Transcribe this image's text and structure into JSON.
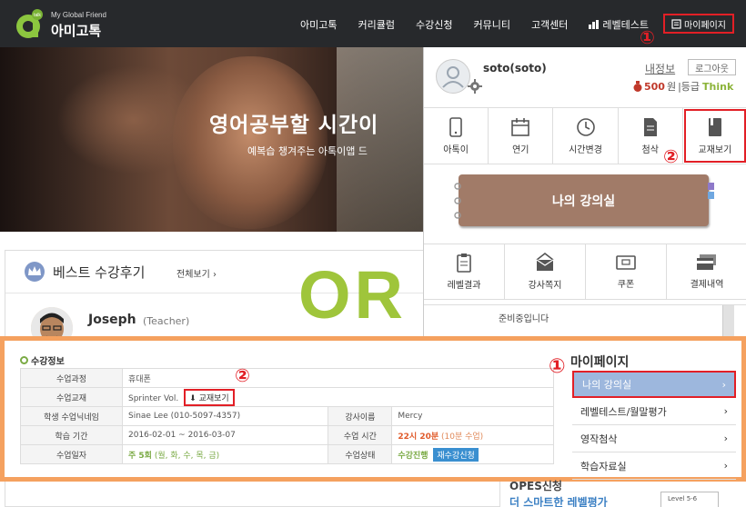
{
  "header": {
    "logo_small": "My Global Friend",
    "logo_text": "아미고톡",
    "nav": [
      "아미고톡",
      "커리큘럼",
      "수강신청",
      "커뮤니티",
      "고객센터"
    ],
    "level_test": "레벨테스트",
    "mypage": "마이페이지"
  },
  "markers": {
    "one": "①",
    "two": "②"
  },
  "hero": {
    "title": "영어공부할 시간이",
    "subtitle": "예복습 챙겨주는 아톡이앱 드"
  },
  "review": {
    "title": "베스트 수강후기",
    "view_all": "전체보기 ›",
    "name": "Joseph",
    "role": "(Teacher)"
  },
  "or_text": "OR",
  "dropdown": {
    "username": "soto(soto)",
    "my_info": "내정보",
    "logout": "로그아웃",
    "points": "500",
    "won": "원",
    "grade_label": "|등급",
    "grade": "Think",
    "row1": [
      "아톡이",
      "연기",
      "시간변경",
      "첨삭",
      "교재보기"
    ],
    "classroom": "나의 강의실",
    "row2": [
      "레벨결과",
      "강사쪽지",
      "쿠폰",
      "결제내역"
    ],
    "list_text": "준비중입니다"
  },
  "course": {
    "heading": "수강정보",
    "rows": {
      "course_label": "수업과정",
      "course_value": "휴대폰",
      "book_label": "수업교재",
      "book_value": "Sprinter Vol.",
      "book_button": "교재보기",
      "nickname_label": "학생 수업닉네임",
      "nickname_value": "Sinae Lee (010-5097-4357)",
      "teacher_label": "강사이름",
      "teacher_value": "Mercy",
      "period_label": "학습 기간",
      "period_value": "2016-02-01 ~ 2016-03-07",
      "time_label": "수업 시간",
      "time_value": "22시 20분",
      "time_note": "(10분 수업)",
      "days_label": "수업일자",
      "days_value": "주 5회",
      "days_note": "(월, 화, 수, 목, 금)",
      "status_label": "수업상태",
      "status_value": "수강진행",
      "status_button": "재수강신청"
    }
  },
  "sidemenu": {
    "title": "마이페이지",
    "items": [
      "나의 강의실",
      "레벨테스트/월말평가",
      "영작첨삭",
      "학습자료실"
    ]
  },
  "bottom": {
    "opes1": "OPES신청",
    "opes2": "더 스마트한 레벨평가",
    "level_card": "Level 5-6"
  },
  "colors": {
    "nav_bg": "#27292c",
    "highlight_red": "#e21f26",
    "orange_border": "#f5a15f",
    "or_green": "#9fc53b",
    "classroom_brown": "#a17b68",
    "active_blue": "#9db7dd"
  }
}
